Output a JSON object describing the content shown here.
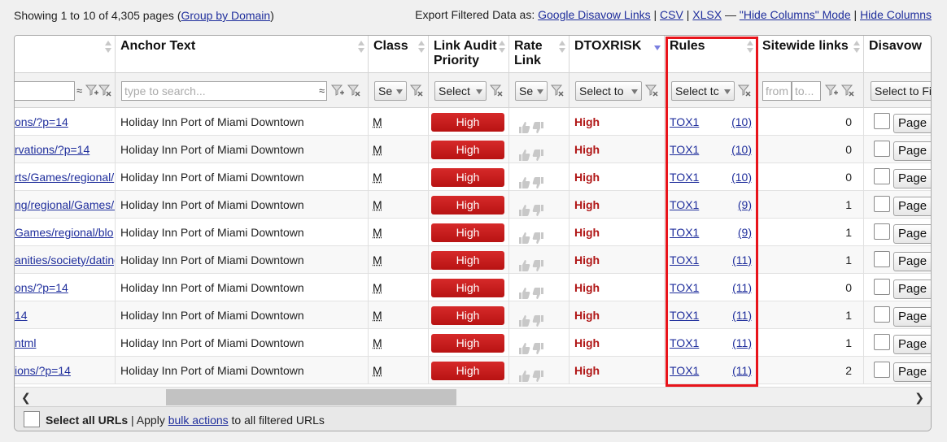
{
  "topbar": {
    "showing_text": "Showing 1 to 10 of 4,305 pages (",
    "group_by_domain": "Group by Domain",
    "showing_close": ")",
    "export_label": "Export Filtered Data as:",
    "google_disavow": "Google Disavow Links",
    "sep1": "|",
    "csv": "CSV",
    "sep2": "|",
    "xlsx": "XLSX",
    "dash": "—",
    "hide_columns_mode": "\"Hide Columns\" Mode",
    "sep3": "|",
    "hide_columns": "Hide Columns"
  },
  "columns": {
    "anchor_text": "Anchor Text",
    "class": "Class",
    "link_audit_priority": "Link Audit Priority",
    "rate_link": "Rate Link",
    "dtoxrisk": "DTOXRISK",
    "rules": "Rules",
    "sitewide_links": "Sitewide links",
    "disavow": "Disavow"
  },
  "filters": {
    "anchor_placeholder": "type to search...",
    "class_select": "Se",
    "priority_select": "Select",
    "rate_select": "Se",
    "dtoxrisk_select": "Select to",
    "rules_select": "Select tc",
    "sitewide_from": "from",
    "sitewide_to": "to...",
    "disavow_select": "Select to Fi",
    "approx_symbol": "≈"
  },
  "rows": [
    {
      "url": "ons/?p=14",
      "anchor": "Holiday Inn Port of Miami Downtown",
      "class": "M",
      "priority": "High",
      "risk": "High",
      "rule": "TOX1",
      "rule_count": "(10)",
      "sitewide": "0",
      "disavow_btn": "Page"
    },
    {
      "url": "rvations/?p=14",
      "anchor": "Holiday Inn Port of Miami Downtown",
      "class": "M",
      "priority": "High",
      "risk": "High",
      "rule": "TOX1",
      "rule_count": "(10)",
      "sitewide": "0",
      "disavow_btn": "Page"
    },
    {
      "url": "rts/Games/regional/",
      "anchor": "Holiday Inn Port of Miami Downtown",
      "class": "M",
      "priority": "High",
      "risk": "High",
      "rule": "TOX1",
      "rule_count": "(10)",
      "sitewide": "0",
      "disavow_btn": "Page"
    },
    {
      "url": "ng/regional/Games/r",
      "anchor": "Holiday Inn Port of Miami Downtown",
      "class": "M",
      "priority": "High",
      "risk": "High",
      "rule": "TOX1",
      "rule_count": "(9)",
      "sitewide": "1",
      "disavow_btn": "Page"
    },
    {
      "url": "Games/regional/blo",
      "anchor": "Holiday Inn Port of Miami Downtown",
      "class": "M",
      "priority": "High",
      "risk": "High",
      "rule": "TOX1",
      "rule_count": "(9)",
      "sitewide": "1",
      "disavow_btn": "Page"
    },
    {
      "url": "anities/society/dating",
      "anchor": "Holiday Inn Port of Miami Downtown",
      "class": "M",
      "priority": "High",
      "risk": "High",
      "rule": "TOX1",
      "rule_count": "(11)",
      "sitewide": "1",
      "disavow_btn": "Page"
    },
    {
      "url": "ons/?p=14",
      "anchor": "Holiday Inn Port of Miami Downtown",
      "class": "M",
      "priority": "High",
      "risk": "High",
      "rule": "TOX1",
      "rule_count": "(11)",
      "sitewide": "0",
      "disavow_btn": "Page"
    },
    {
      "url": "14",
      "anchor": "Holiday Inn Port of Miami Downtown",
      "class": "M",
      "priority": "High",
      "risk": "High",
      "rule": "TOX1",
      "rule_count": "(11)",
      "sitewide": "1",
      "disavow_btn": "Page"
    },
    {
      "url": "ntml",
      "anchor": "Holiday Inn Port of Miami Downtown",
      "class": "M",
      "priority": "High",
      "risk": "High",
      "rule": "TOX1",
      "rule_count": "(11)",
      "sitewide": "1",
      "disavow_btn": "Page"
    },
    {
      "url": "ions/?p=14",
      "anchor": "Holiday Inn Port of Miami Downtown",
      "class": "M",
      "priority": "High",
      "risk": "High",
      "rule": "TOX1",
      "rule_count": "(11)",
      "sitewide": "2",
      "disavow_btn": "Page"
    }
  ],
  "footer": {
    "select_all": "Select all URLs",
    "apply_text": " | Apply ",
    "bulk_actions": "bulk actions",
    "suffix": " to all filtered URLs"
  },
  "scroll": {
    "left_arrow": "❮",
    "right_arrow": "❯"
  },
  "icons": {
    "filter": "filter-funnel-icon",
    "clear_filter": "clear-filter-icon",
    "thumb_up": "thumb-up-icon",
    "thumb_down": "thumb-down-icon"
  },
  "colors": {
    "priority_high": "#c41b1b",
    "risk_high": "#b01616",
    "link": "#1f2e9c",
    "highlight": "#e8141b"
  }
}
